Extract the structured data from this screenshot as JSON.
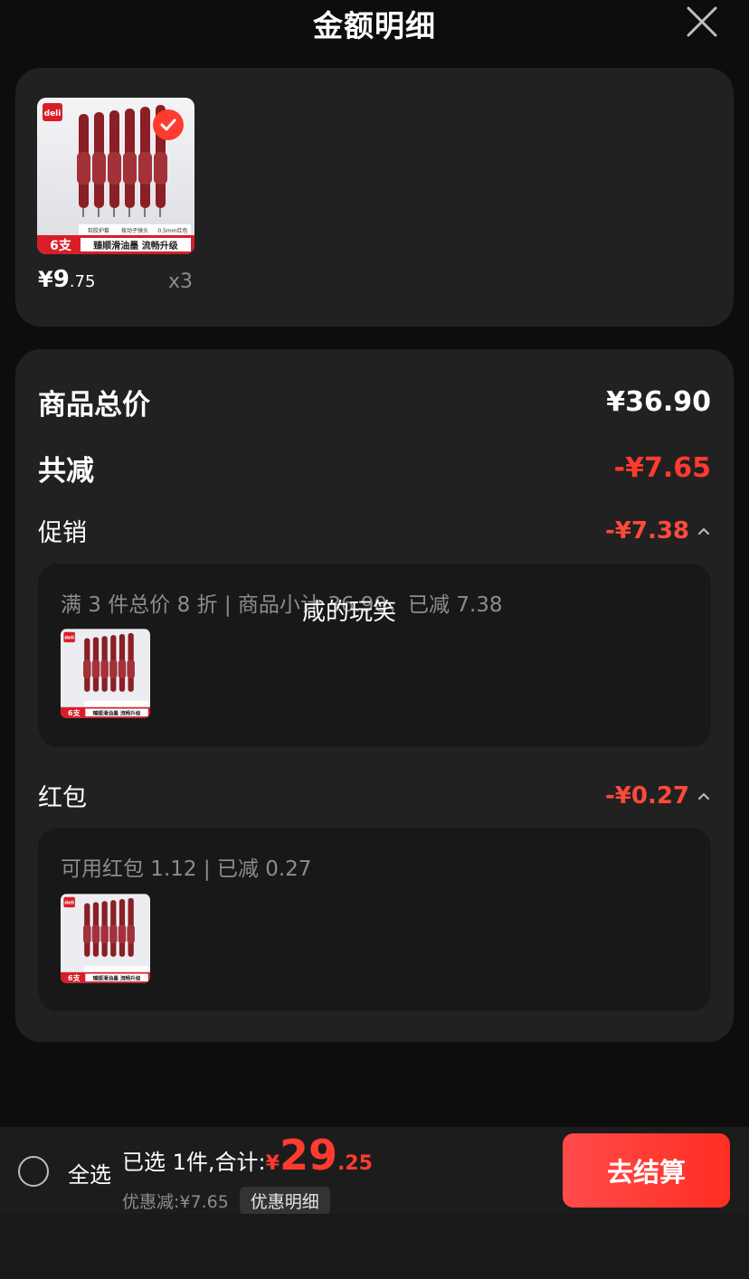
{
  "header": {
    "title": "金额明细"
  },
  "product": {
    "brand_logo": "deli",
    "pack_label": "6支",
    "features": [
      "软胶护套",
      "按动子弹头",
      "0.5mm红色"
    ],
    "slogan": "臻顺滑油墨 流畅升级",
    "price_symbol": "¥",
    "price_int": "9",
    "price_dec": ".75",
    "quantity": "x3"
  },
  "details": {
    "total_label": "商品总价",
    "total_value": "¥36.90",
    "reduce_label": "共减",
    "reduce_value": "-¥7.65",
    "promo": {
      "label": "促销",
      "value": "-¥7.38",
      "desc": "满 3 件总价 8 折 | 商品小计 36.90，已减 7.38"
    },
    "redpacket": {
      "label": "红包",
      "value": "-¥0.27",
      "desc": "可用红包 1.12 | 已减 0.27"
    },
    "overlay_text": "咸的玩笑"
  },
  "bottom": {
    "select_all": "全选",
    "summary_text": "已选 1件,合计:",
    "total_symbol": "¥",
    "total_int": "29",
    "total_dec": ".25",
    "discount_text": "优惠减:¥7.65",
    "discount_detail_label": "优惠明细",
    "checkout_label": "去结算"
  },
  "colors": {
    "accent": "#ff3b2f",
    "card": "#212121",
    "bg": "#0d0d0d"
  }
}
